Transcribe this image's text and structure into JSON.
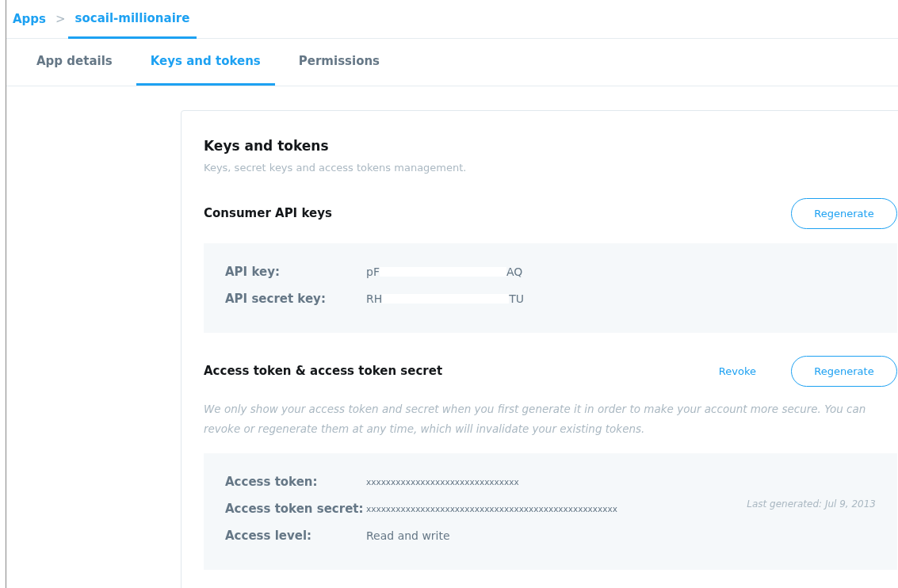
{
  "breadcrumb": {
    "root": "Apps",
    "separator": ">",
    "current": "socail-millionaire"
  },
  "tabs": [
    {
      "label": "App details",
      "selected": false
    },
    {
      "label": "Keys and tokens",
      "selected": true
    },
    {
      "label": "Permissions",
      "selected": false
    }
  ],
  "card": {
    "title": "Keys and tokens",
    "subtitle": "Keys, secret keys and access tokens management.",
    "sections": [
      {
        "title": "Consumer API keys",
        "button": "Regenerate",
        "rows": [
          {
            "kind": "redacted",
            "label": "API key:",
            "value_start": "pF",
            "value_end": "AQ"
          },
          {
            "kind": "redacted",
            "label": "API secret key:",
            "value_start": "RH",
            "value_end": "TU"
          }
        ]
      },
      {
        "title": "Access token & access token secret",
        "link": "Revoke",
        "button": "Regenerate",
        "description": "We only show your access token and secret when you first generate it in order to make your account more secure. You can revoke or regenerate them at any time, which will invalidate your existing tokens.",
        "note": "Last generated: Jul 9, 2013",
        "rows": [
          {
            "kind": "masked",
            "label": "Access token:",
            "value_start": "xxxxxxxxxxxxxxxxxxxxxxxxxxxxxxx"
          },
          {
            "kind": "masked",
            "label": "Access token secret:",
            "value_start": "xxxxxxxxxxxxxxxxxxxxxxxxxxxxxxxxxxxxxxxxxxxxxxxxxxx"
          },
          {
            "kind": "plain",
            "label": "Access level:",
            "value_start": "Read and write"
          }
        ]
      }
    ]
  }
}
